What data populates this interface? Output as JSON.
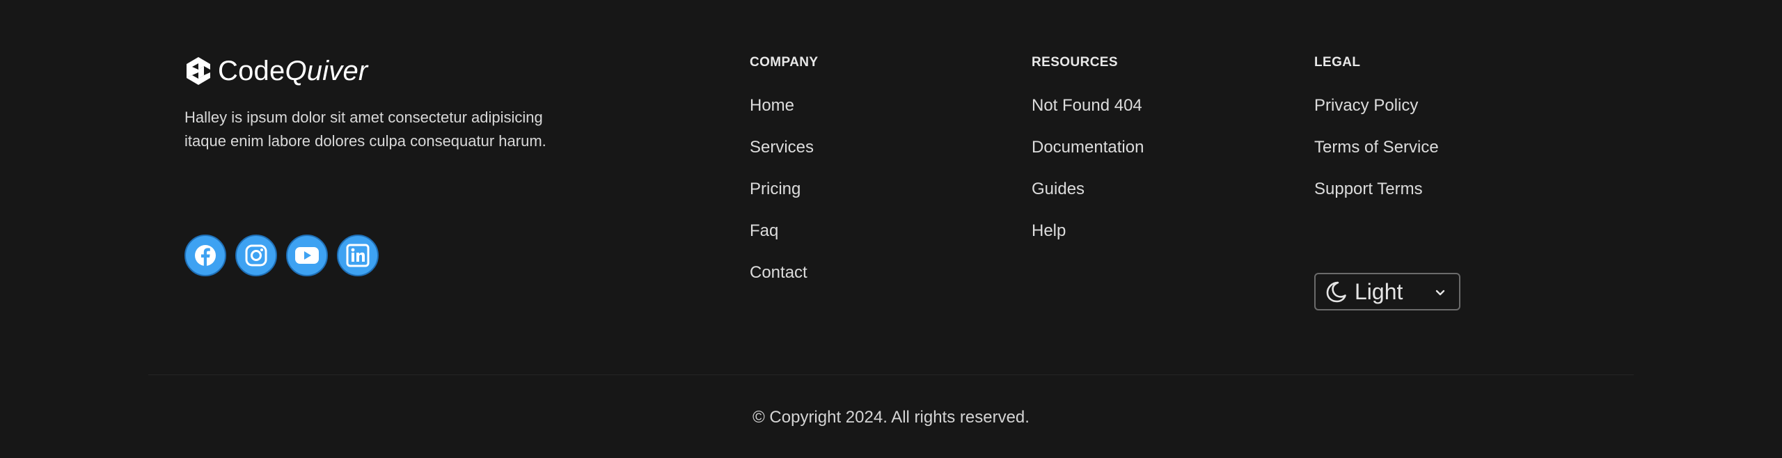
{
  "brand": {
    "name_regular": "Code",
    "name_italic": "Quiver",
    "description": "Halley is ipsum dolor sit amet consectetur adipisicing itaque enim labore dolores culpa consequatur harum."
  },
  "socials": [
    {
      "icon": "facebook-icon"
    },
    {
      "icon": "instagram-icon"
    },
    {
      "icon": "youtube-icon"
    },
    {
      "icon": "linkedin-icon"
    }
  ],
  "columns": {
    "company": {
      "title": "COMPANY",
      "links": [
        "Home",
        "Services",
        "Pricing",
        "Faq",
        "Contact"
      ]
    },
    "resources": {
      "title": "RESOURCES",
      "links": [
        "Not Found 404",
        "Documentation",
        "Guides",
        "Help"
      ]
    },
    "legal": {
      "title": "LEGAL",
      "links": [
        "Privacy Policy",
        "Terms of Service",
        "Support Terms"
      ]
    }
  },
  "theme_select": {
    "icon": "moon-icon",
    "value": "Light"
  },
  "footer": {
    "copyright": "© Copyright 2024. All rights reserved."
  },
  "colors": {
    "background": "#171717",
    "social_accent": "#3ea2f2",
    "text": "#e5e5e5"
  }
}
